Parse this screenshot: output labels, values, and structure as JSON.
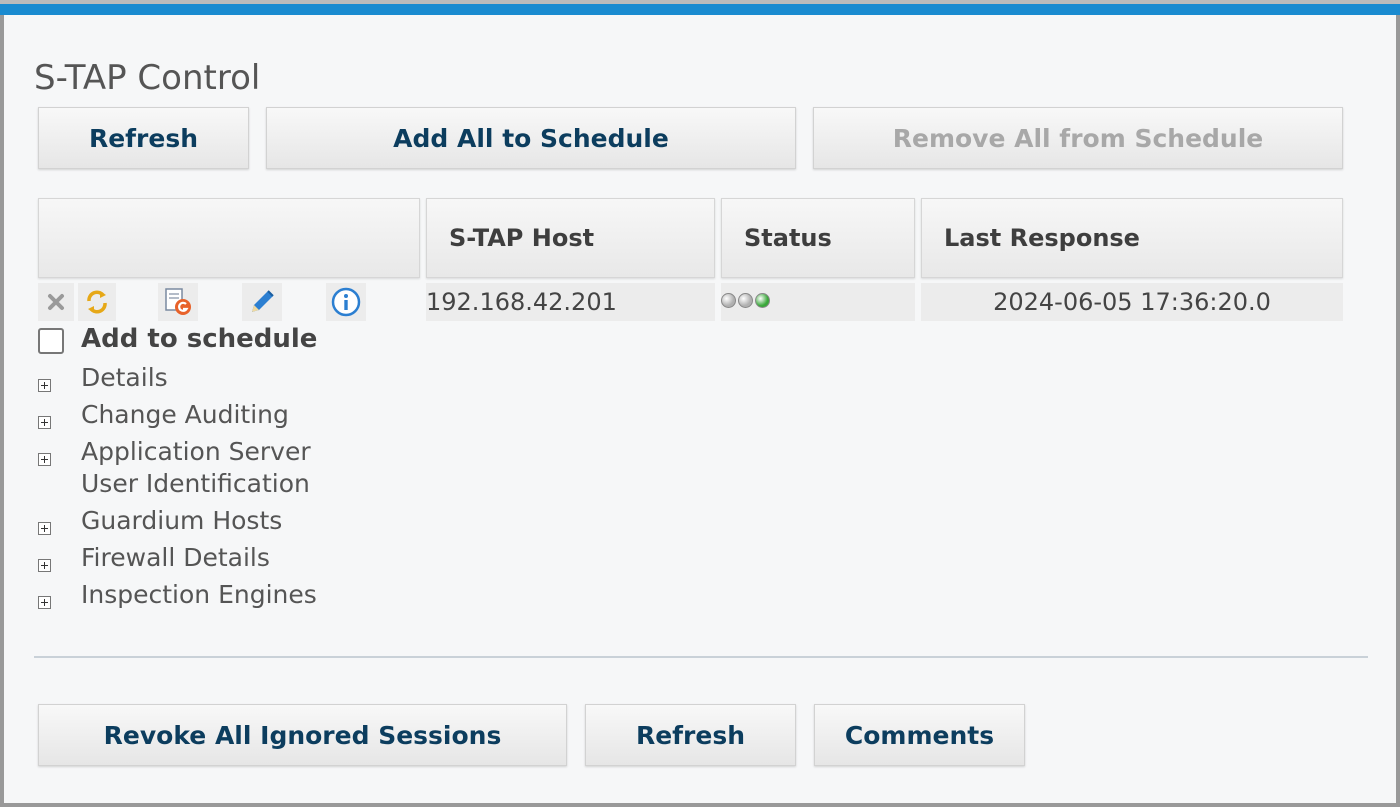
{
  "title": "S-TAP Control",
  "top_buttons": {
    "refresh": "Refresh",
    "add_all": "Add All to Schedule",
    "remove_all": "Remove All from Schedule"
  },
  "table": {
    "headers": [
      "",
      "S-TAP Host",
      "Status",
      "Last Response"
    ],
    "row": {
      "icons": [
        "delete-icon",
        "refresh-icon",
        "report-icon",
        "edit-icon",
        "info-icon"
      ],
      "host": "192.168.42.201",
      "status_lights": [
        "#b0b0b0",
        "#b0b0b0",
        "#3aa83a"
      ],
      "last_response": "2024-06-05 17:36:20.0"
    }
  },
  "add_to_schedule": {
    "label": "Add to schedule",
    "checked": false
  },
  "sections": [
    "Details",
    "Change Auditing",
    "Application Server",
    "User Identification",
    "Guardium Hosts",
    "Firewall Details",
    "Inspection Engines"
  ],
  "bottom_buttons": {
    "revoke": "Revoke All Ignored Sessions",
    "refresh": "Refresh",
    "comments": "Comments"
  },
  "colors": {
    "accent": "#1a8bd0",
    "button_text": "#0c3d5e"
  }
}
